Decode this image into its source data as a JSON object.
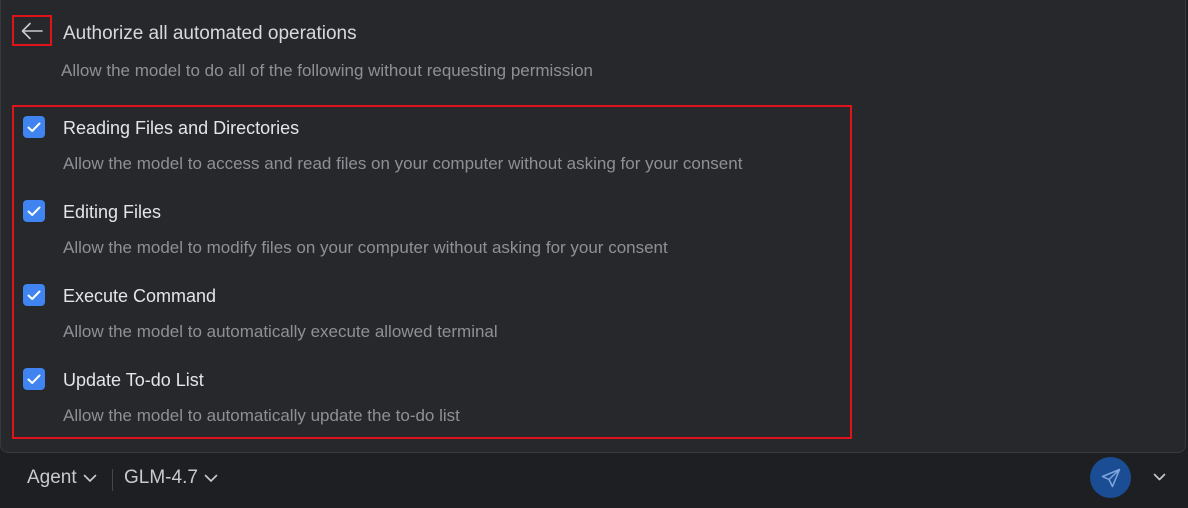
{
  "header": {
    "back_icon": "arrow-left-icon",
    "title": "Authorize all automated operations",
    "subtitle": "Allow the model to do all of the following without requesting permission"
  },
  "options": [
    {
      "label": "Reading Files and Directories",
      "description": "Allow the model to access and read files on your computer without asking for your consent",
      "checked": true
    },
    {
      "label": "Editing Files",
      "description": "Allow the model to modify files on your computer without asking for your consent",
      "checked": true
    },
    {
      "label": "Execute Command",
      "description": "Allow the model to automatically execute allowed terminal",
      "checked": true
    },
    {
      "label": "Update To-do List",
      "description": "Allow the model to automatically update the to-do list",
      "checked": true
    }
  ],
  "bottom_bar": {
    "mode": "Agent",
    "model": "GLM-4.7",
    "send_icon": "send-icon",
    "more_icon": "chevron-down-icon"
  },
  "colors": {
    "accent": "#3f84f0",
    "highlight": "#e0121a",
    "send_button": "#1a4d93"
  }
}
